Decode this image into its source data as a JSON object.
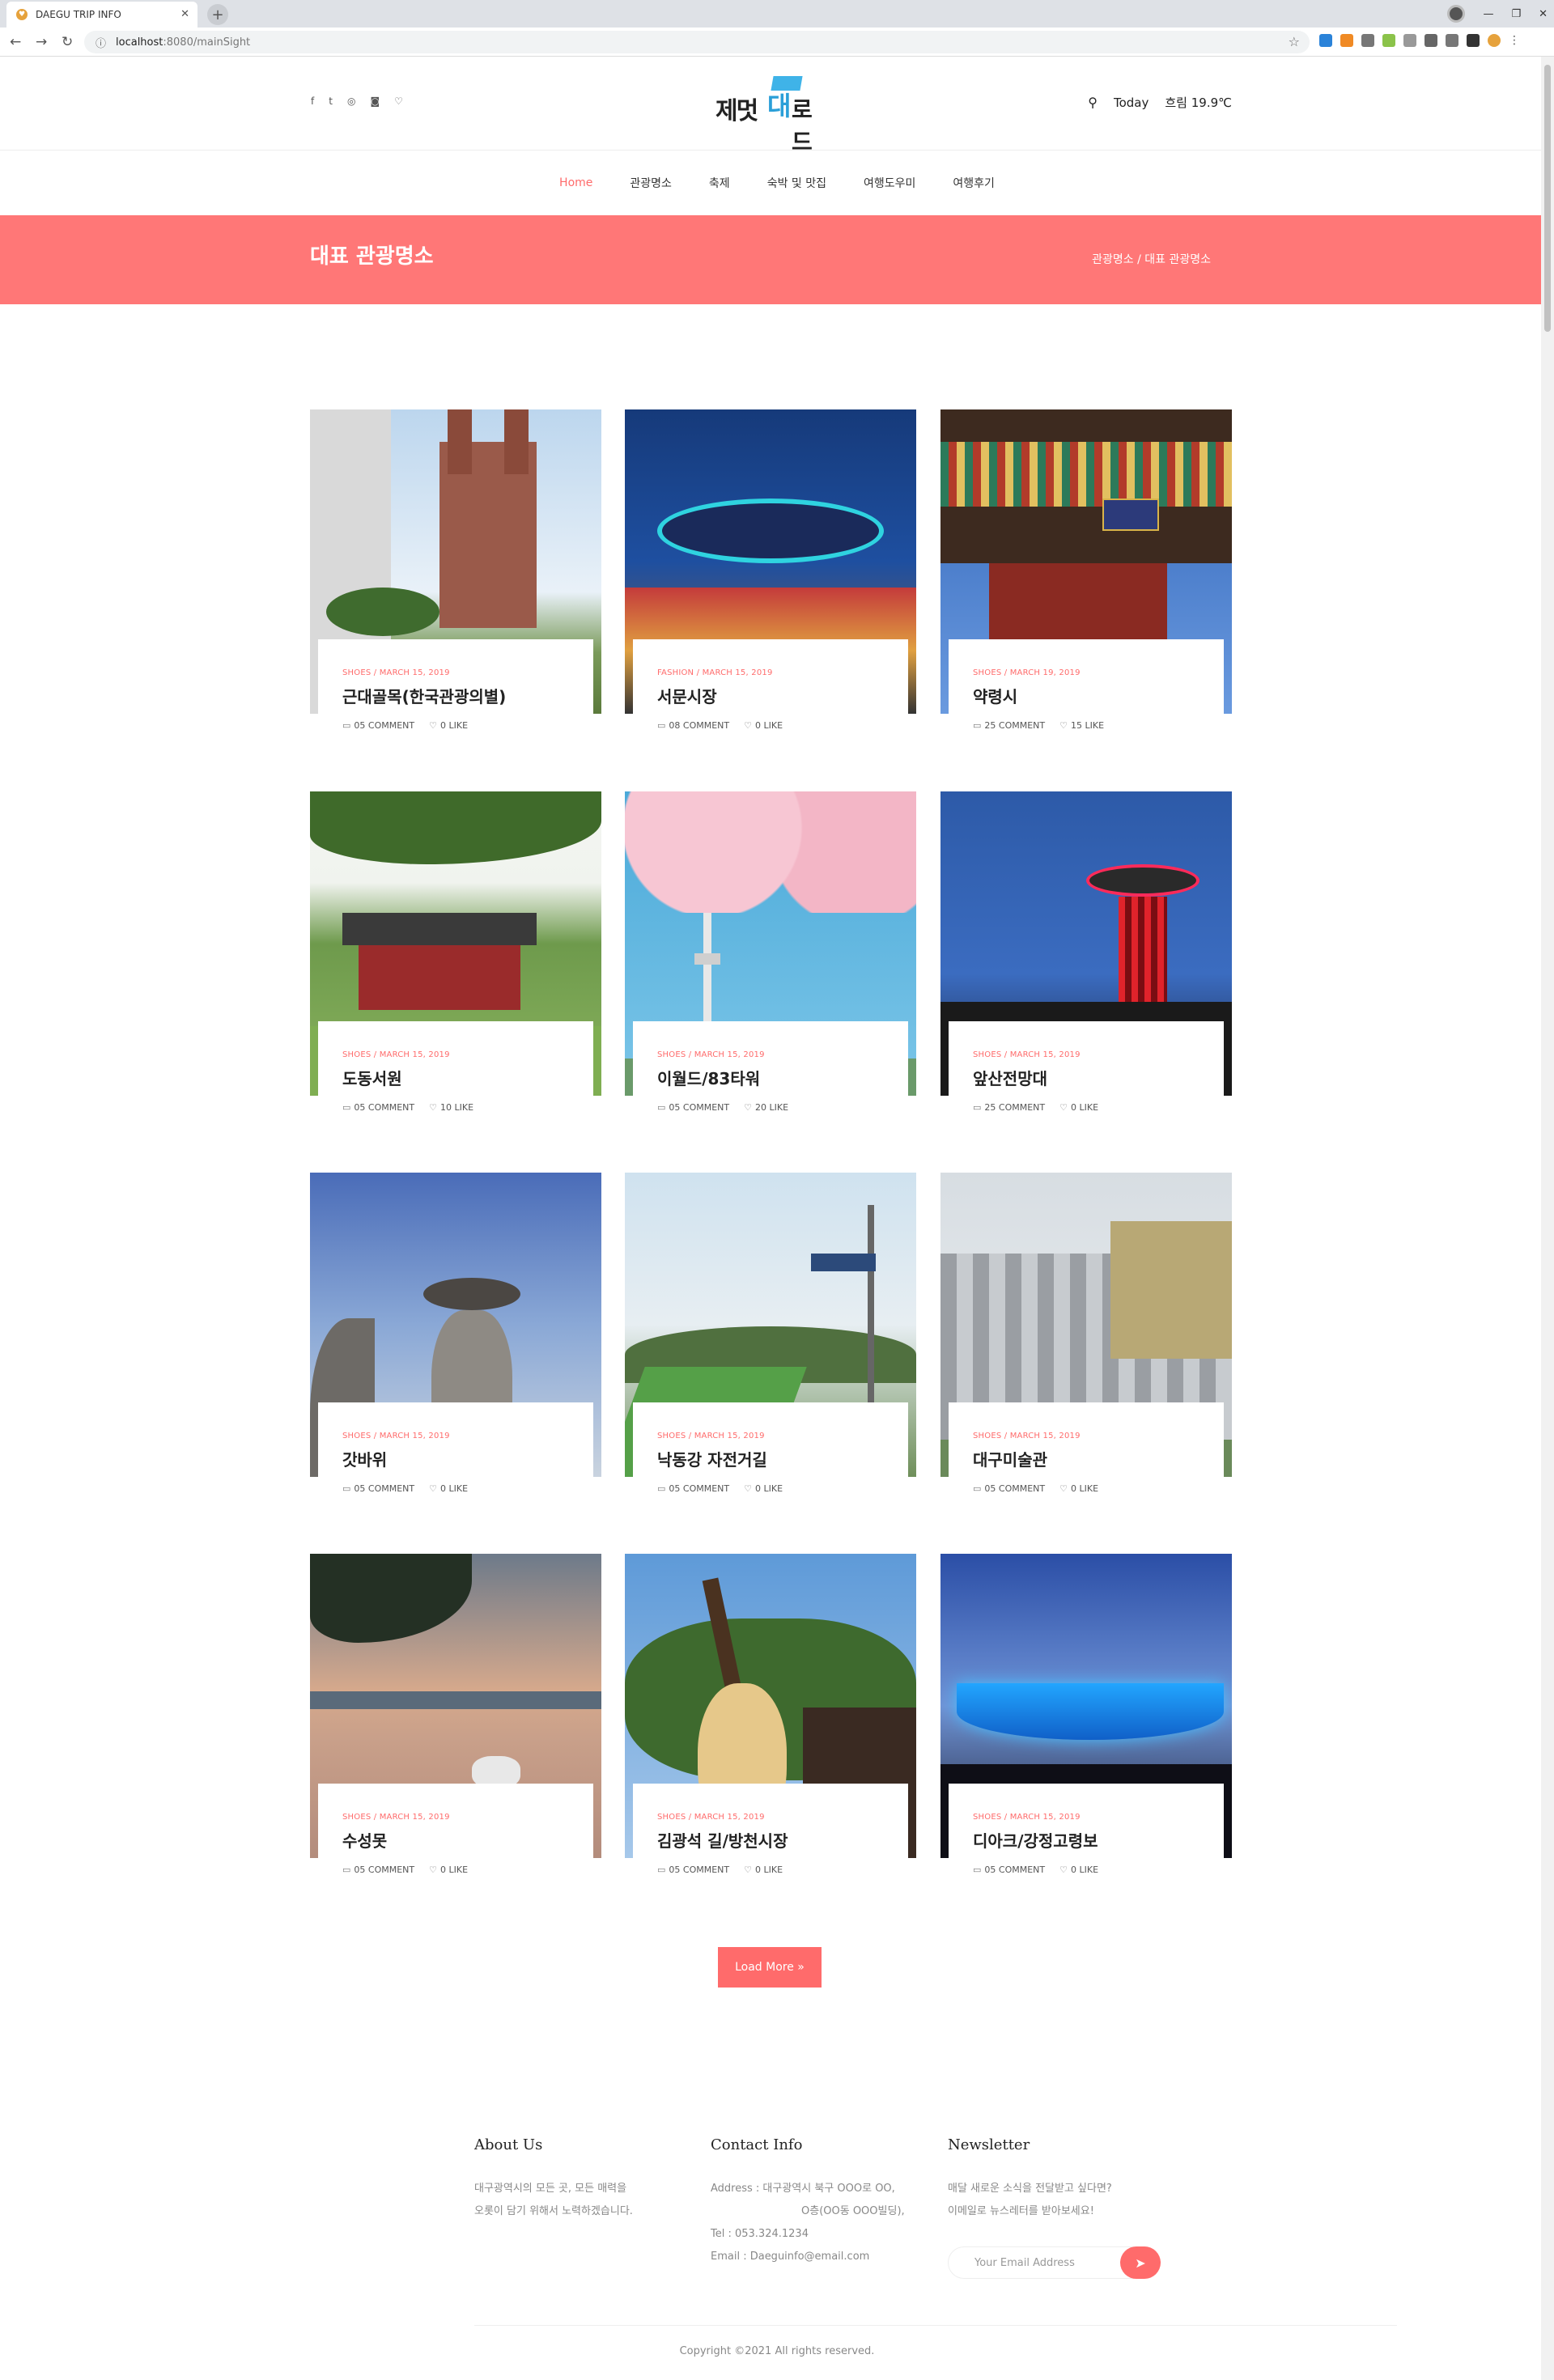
{
  "browser": {
    "tab_title": "DAEGU TRIP INFO",
    "url_prefix": "localhost",
    "url_rest": ":8080/mainSight"
  },
  "header": {
    "socials": [
      "f",
      "t",
      "◎",
      "◙",
      "♡"
    ],
    "logo_parts": [
      "제멋",
      "대",
      "로드"
    ],
    "today_label": "Today",
    "weather": "흐림 19.9℃"
  },
  "nav": [
    "Home",
    "관광명소",
    "축제",
    "숙박 및 맛집",
    "여행도우미",
    "여행후기"
  ],
  "banner": {
    "title": "대표 관광명소",
    "breadcrumb": "관광명소 / 대표 관광명소"
  },
  "cards": [
    {
      "meta": "SHOES / MARCH 15, 2019",
      "title": "근대골목(한국관광의별)",
      "comments": "05 COMMENT",
      "likes": "0 LIKE"
    },
    {
      "meta": "FASHION / MARCH 15, 2019",
      "title": "서문시장",
      "comments": "08 COMMENT",
      "likes": "0 LIKE"
    },
    {
      "meta": "SHOES / MARCH 19, 2019",
      "title": "약령시",
      "comments": "25 COMMENT",
      "likes": "15 LIKE"
    },
    {
      "meta": "SHOES / MARCH 15, 2019",
      "title": "도동서원",
      "comments": "05 COMMENT",
      "likes": "10 LIKE"
    },
    {
      "meta": "SHOES / MARCH 15, 2019",
      "title": "이월드/83타워",
      "comments": "05 COMMENT",
      "likes": "20 LIKE"
    },
    {
      "meta": "SHOES / MARCH 15, 2019",
      "title": "앞산전망대",
      "comments": "25 COMMENT",
      "likes": "0 LIKE"
    },
    {
      "meta": "SHOES / MARCH 15, 2019",
      "title": "갓바위",
      "comments": "05 COMMENT",
      "likes": "0 LIKE"
    },
    {
      "meta": "SHOES / MARCH 15, 2019",
      "title": "낙동강 자전거길",
      "comments": "05 COMMENT",
      "likes": "0 LIKE"
    },
    {
      "meta": "SHOES / MARCH 15, 2019",
      "title": "대구미술관",
      "comments": "05 COMMENT",
      "likes": "0 LIKE"
    },
    {
      "meta": "SHOES / MARCH 15, 2019",
      "title": "수성못",
      "comments": "05 COMMENT",
      "likes": "0 LIKE"
    },
    {
      "meta": "SHOES / MARCH 15, 2019",
      "title": "김광석 길/방천시장",
      "comments": "05 COMMENT",
      "likes": "0 LIKE"
    },
    {
      "meta": "SHOES / MARCH 15, 2019",
      "title": "디아크/강정고령보",
      "comments": "05 COMMENT",
      "likes": "0 LIKE"
    }
  ],
  "load_more": "Load More »",
  "footer": {
    "about_title": "About Us",
    "about_text_1": "대구광역시의 모든 곳, 모든 매력을",
    "about_text_2": "오롯이 담기 위해서 노력하겠습니다.",
    "contact_title": "Contact Info",
    "address_1": "Address : 대구광역시 북구 OOO로 OO,",
    "address_2": "O층(OO동 OOO빌딩),",
    "tel": "Tel : 053.324.1234",
    "email": "Email : Daeguinfo@email.com",
    "news_title": "Newsletter",
    "news_text_1": "매달 새로운 소식을 전달받고 싶다면?",
    "news_text_2": "이메일로 뉴스레터를 받아보세요!",
    "news_placeholder": "Your Email Address",
    "copyright": "Copyright ©2021 All rights reserved."
  }
}
